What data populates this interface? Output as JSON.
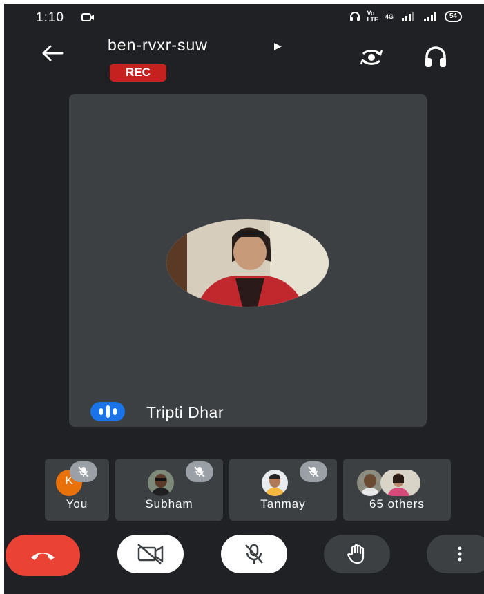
{
  "status_bar": {
    "time": "1:10",
    "network_top": "Vo",
    "network_bottom": "LTE",
    "data_label": "4G",
    "battery": "54"
  },
  "header": {
    "meeting_code": "ben-rvxr-suw",
    "recording_badge": "REC",
    "icons": [
      "back-arrow-icon",
      "switch-camera-icon",
      "headphones-icon"
    ]
  },
  "main_tile": {
    "speaker_name": "Tripti Dhar",
    "speaking": true
  },
  "participants": [
    {
      "label": "You",
      "initial": "K",
      "muted": true,
      "avatar_color": "#e8710a"
    },
    {
      "label": "Subham",
      "muted": true
    },
    {
      "label": "Tanmay",
      "muted": true
    },
    {
      "label": "65 others"
    }
  ],
  "controls": [
    {
      "name": "end-call",
      "icon": "phone-hangup-icon",
      "color": "#ea4335"
    },
    {
      "name": "camera",
      "icon": "video-off-icon",
      "state": "off"
    },
    {
      "name": "microphone",
      "icon": "mic-off-icon",
      "state": "off"
    },
    {
      "name": "raise-hand",
      "icon": "hand-icon"
    },
    {
      "name": "more-options",
      "icon": "more-vert-icon"
    }
  ],
  "colors": {
    "background": "#202124",
    "tile": "#3c4043",
    "rec": "#c5221f",
    "end_call": "#ea4335",
    "speaking_indicator": "#1a73e8"
  }
}
